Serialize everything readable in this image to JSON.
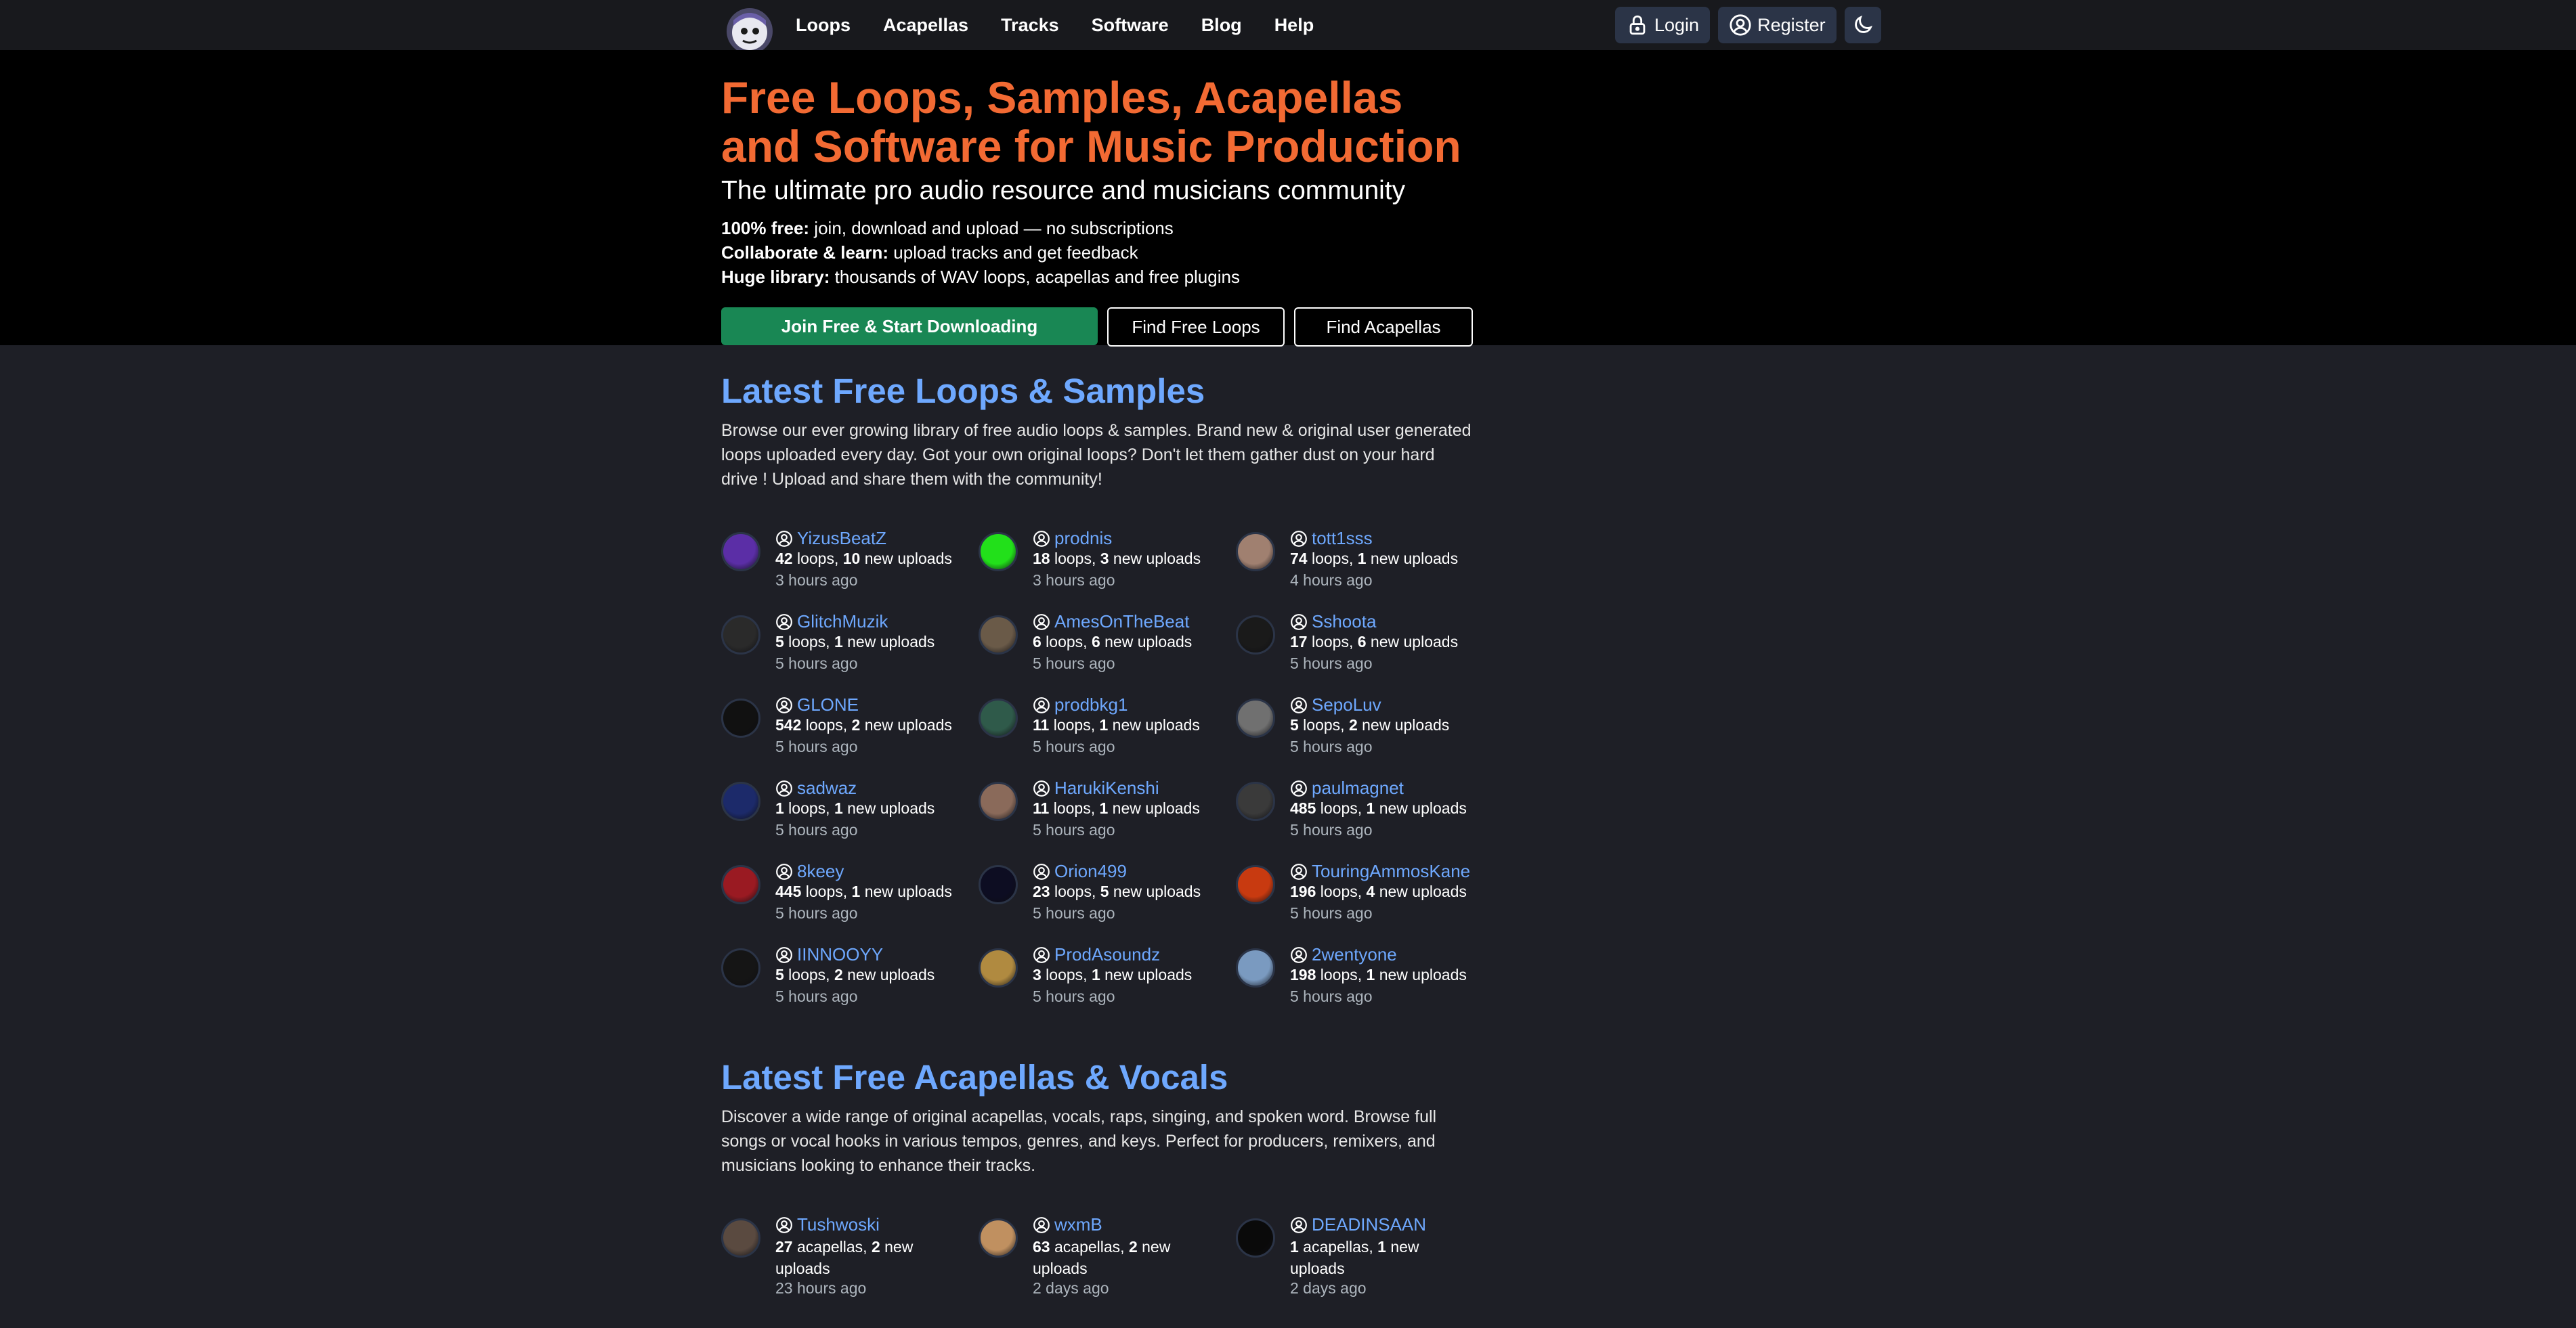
{
  "nav": {
    "links": [
      "Loops",
      "Acapellas",
      "Tracks",
      "Software",
      "Blog",
      "Help"
    ],
    "login": "Login",
    "register": "Register"
  },
  "hero": {
    "title": "Free Loops, Samples, Acapellas and Software for Music Production",
    "subtitle": "The ultimate pro audio resource and musicians community",
    "features": [
      {
        "bold": "100% free:",
        "text": " join, download and upload — no subscriptions"
      },
      {
        "bold": "Collaborate & learn:",
        "text": " upload tracks and get feedback"
      },
      {
        "bold": "Huge library:",
        "text": " thousands of WAV loops, acapellas and free plugins"
      }
    ],
    "join_button": "Join Free & Start Downloading",
    "find_loops_button": "Find Free Loops",
    "find_acapellas_button": "Find Acapellas"
  },
  "loops_section": {
    "title": "Latest Free Loops & Samples",
    "description": "Browse our ever growing library of free audio loops & samples. Brand new & original user generated loops uploaded every day. Got your own original loops? Don't let them gather dust on your hard drive ! Upload and share them with the community!",
    "users": [
      {
        "name": "YizusBeatZ",
        "count": "42",
        "unit": " loops, ",
        "new": "10",
        "new_label": " new uploads",
        "time": "3 hours ago",
        "color": "#5b2ea6"
      },
      {
        "name": "prodnis",
        "count": "18",
        "unit": " loops, ",
        "new": "3",
        "new_label": " new uploads",
        "time": "3 hours ago",
        "color": "#22e01a"
      },
      {
        "name": "tott1sss",
        "count": "74",
        "unit": " loops, ",
        "new": "1",
        "new_label": " new uploads",
        "time": "4 hours ago",
        "color": "#a08070"
      },
      {
        "name": "GlitchMuzik",
        "count": "5",
        "unit": " loops, ",
        "new": "1",
        "new_label": " new uploads",
        "time": "5 hours ago",
        "color": "#2a2a2a"
      },
      {
        "name": "AmesOnTheBeat",
        "count": "6",
        "unit": " loops, ",
        "new": "6",
        "new_label": " new uploads",
        "time": "5 hours ago",
        "color": "#6a5a48"
      },
      {
        "name": "Sshoota",
        "count": "17",
        "unit": " loops, ",
        "new": "6",
        "new_label": " new uploads",
        "time": "5 hours ago",
        "color": "#1a1a1a"
      },
      {
        "name": "GLONE",
        "count": "542",
        "unit": " loops, ",
        "new": "2",
        "new_label": " new uploads",
        "time": "5 hours ago",
        "color": "#111111"
      },
      {
        "name": "prodbkg1",
        "count": "11",
        "unit": " loops, ",
        "new": "1",
        "new_label": " new uploads",
        "time": "5 hours ago",
        "color": "#2f5a4a"
      },
      {
        "name": "SepoLuv",
        "count": "5",
        "unit": " loops, ",
        "new": "2",
        "new_label": " new uploads",
        "time": "5 hours ago",
        "color": "#707070"
      },
      {
        "name": "sadwaz",
        "count": "1",
        "unit": " loops, ",
        "new": "1",
        "new_label": " new uploads",
        "time": "5 hours ago",
        "color": "#1c2a6a"
      },
      {
        "name": "HarukiKenshi",
        "count": "11",
        "unit": " loops, ",
        "new": "1",
        "new_label": " new uploads",
        "time": "5 hours ago",
        "color": "#8a6a5a"
      },
      {
        "name": "paulmagnet",
        "count": "485",
        "unit": " loops, ",
        "new": "1",
        "new_label": " new uploads",
        "time": "5 hours ago",
        "color": "#3a3a3a"
      },
      {
        "name": "8keey",
        "count": "445",
        "unit": " loops, ",
        "new": "1",
        "new_label": " new uploads",
        "time": "5 hours ago",
        "color": "#9a1a22"
      },
      {
        "name": "Orion499",
        "count": "23",
        "unit": " loops, ",
        "new": "5",
        "new_label": " new uploads",
        "time": "5 hours ago",
        "color": "#0d0d22"
      },
      {
        "name": "TouringAmmosKane",
        "count": "196",
        "unit": " loops, ",
        "new": "4",
        "new_label": " new uploads",
        "time": "5 hours ago",
        "color": "#c83a10"
      },
      {
        "name": "IINNOOYY",
        "count": "5",
        "unit": " loops, ",
        "new": "2",
        "new_label": " new uploads",
        "time": "5 hours ago",
        "color": "#151515"
      },
      {
        "name": "ProdAsoundz",
        "count": "3",
        "unit": " loops, ",
        "new": "1",
        "new_label": " new uploads",
        "time": "5 hours ago",
        "color": "#b08a40"
      },
      {
        "name": "2wentyone",
        "count": "198",
        "unit": " loops, ",
        "new": "1",
        "new_label": " new uploads",
        "time": "5 hours ago",
        "color": "#7a9ac0"
      }
    ]
  },
  "acapellas_section": {
    "title": "Latest Free Acapellas & Vocals",
    "description": "Discover a wide range of original acapellas, vocals, raps, singing, and spoken word. Browse full songs or vocal hooks in various tempos, genres, and keys. Perfect for producers, remixers, and musicians looking to enhance their tracks.",
    "users": [
      {
        "name": "Tushwoski",
        "count": "27",
        "unit": " acapellas, ",
        "new": "2",
        "new_label": " new uploads",
        "time": "23 hours ago",
        "color": "#5a4a40"
      },
      {
        "name": "wxmB",
        "count": "63",
        "unit": " acapellas, ",
        "new": "2",
        "new_label": " new uploads",
        "time": "2 days ago",
        "color": "#c09060"
      },
      {
        "name": "DEADINSAAN",
        "count": "1",
        "unit": " acapellas, ",
        "new": "1",
        "new_label": " new uploads",
        "time": "2 days ago",
        "color": "#0a0a0a"
      }
    ]
  }
}
